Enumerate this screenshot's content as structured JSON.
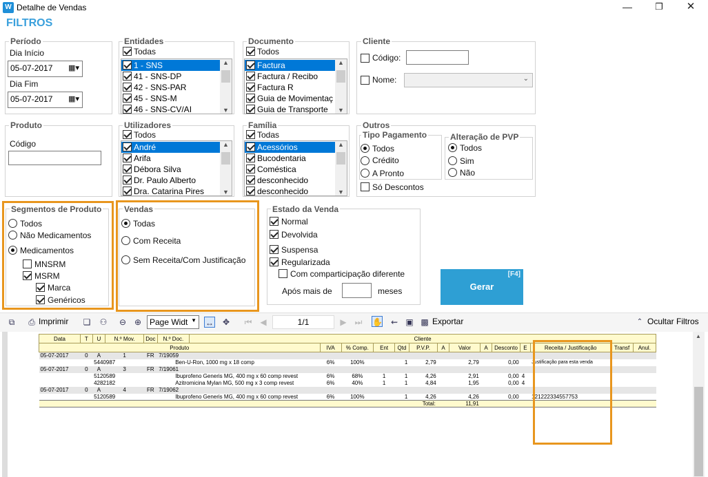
{
  "window": {
    "title": "Detalhe de Vendas",
    "app_icon": "W"
  },
  "filters_title": "FILTROS",
  "periodo": {
    "label": "Período",
    "start_label": "Dia Início",
    "start": "05-07-2017",
    "end_label": "Dia Fim",
    "end": "05-07-2017"
  },
  "entidades": {
    "label": "Entidades",
    "all": "Todas",
    "items": [
      "1 - SNS",
      "41 - SNS-DP",
      "42 - SNS-PAR",
      "45 - SNS-M",
      "46 - SNS-CV/AI"
    ]
  },
  "documento": {
    "label": "Documento",
    "all": "Todos",
    "items": [
      "Factura",
      "Factura / Recibo",
      "Factura R",
      "Guia de Movimentaç",
      "Guia de Transporte"
    ]
  },
  "cliente": {
    "label": "Cliente",
    "codigo": "Código:",
    "nome": "Nome:"
  },
  "produto": {
    "label": "Produto",
    "codigo": "Código"
  },
  "utilizadores": {
    "label": "Utilizadores",
    "all": "Todos",
    "items": [
      "André",
      "Arifa",
      "Débora Silva",
      "Dr. Paulo Alberto",
      "Dra. Catarina Pires"
    ]
  },
  "familia": {
    "label": "Família",
    "all": "Todas",
    "items": [
      "Acessórios",
      "Bucodentaria",
      "Coméstica",
      "desconhecido",
      "desconhecido"
    ]
  },
  "outros": {
    "label": "Outros",
    "tipo_label": "Tipo Pagamento",
    "tipo": [
      "Todos",
      "Crédito",
      "A Pronto"
    ],
    "so_descontos": "Só Descontos",
    "pvp_label": "Alteração de PVP",
    "pvp": [
      "Todos",
      "Sim",
      "Não"
    ]
  },
  "segmentos": {
    "label": "Segmentos de Produto",
    "todos": "Todos",
    "nao_med": "Não Medicamentos",
    "med": "Medicamentos",
    "mnsrm": "MNSRM",
    "msrm": "MSRM",
    "marca": "Marca",
    "genericos": "Genéricos"
  },
  "vendas": {
    "label": "Vendas",
    "todas": "Todas",
    "com_receita": "Com Receita",
    "sem_receita": "Sem Receita/Com Justificação"
  },
  "estado": {
    "label": "Estado da Venda",
    "normal": "Normal",
    "devolvida": "Devolvida",
    "suspensa": "Suspensa",
    "regularizada": "Regularizada",
    "compart": "Com comparticipação diferente",
    "apos": "Após mais de",
    "meses": "meses"
  },
  "gerar": {
    "label": "Gerar",
    "shortcut": "[F4]"
  },
  "toolbar": {
    "imprimir": "Imprimir",
    "page_width": "Page Widt",
    "page": "1/1",
    "exportar": "Exportar",
    "ocultar": "Ocultar Filtros"
  },
  "report": {
    "h1": [
      "Data",
      "T",
      "U",
      "N.º Mov.",
      "Doc",
      "N.º Doc.",
      "Cliente"
    ],
    "h2": [
      "Produto",
      "IVA",
      "% Comp.",
      "Ent",
      "Qtd",
      "P.V.P.",
      "A",
      "Valor",
      "A",
      "Desconto",
      "E",
      "Receita / Justificação",
      "Transf",
      "Anul."
    ],
    "groups": [
      {
        "date": "05-07-2017",
        "t": "0",
        "u": "A",
        "mov": "1",
        "doc": "FR",
        "ndoc": "7/19059",
        "rows": [
          [
            "5440987",
            "Ben-U-Ron, 1000 mg x 18 comp",
            "6%",
            "100%",
            "",
            "1",
            "2,79",
            "2,79",
            "0,00",
            "",
            "Justificação para esta venda"
          ]
        ]
      },
      {
        "date": "05-07-2017",
        "t": "0",
        "u": "A",
        "mov": "3",
        "doc": "FR",
        "ndoc": "7/19061",
        "rows": [
          [
            "5120589",
            "Ibuprofeno Generis MG, 400 mg x 60 comp revest",
            "6%",
            "68%",
            "1",
            "1",
            "4,26",
            "2,91",
            "0,00",
            "4",
            ""
          ],
          [
            "4282182",
            "Azitromicina Mylan MG, 500 mg x 3 comp revest",
            "6%",
            "40%",
            "1",
            "1",
            "4,84",
            "1,95",
            "0,00",
            "4",
            ""
          ]
        ]
      },
      {
        "date": "05-07-2017",
        "t": "0",
        "u": "A",
        "mov": "4",
        "doc": "FR",
        "ndoc": "7/19062",
        "rows": [
          [
            "5120589",
            "Ibuprofeno Generis MG, 400 mg x 60 comp revest",
            "6%",
            "100%",
            "",
            "1",
            "4,26",
            "4,26",
            "0,00",
            "",
            "121222334557753"
          ]
        ]
      }
    ],
    "total_label": "Total:",
    "total": "11,91"
  }
}
